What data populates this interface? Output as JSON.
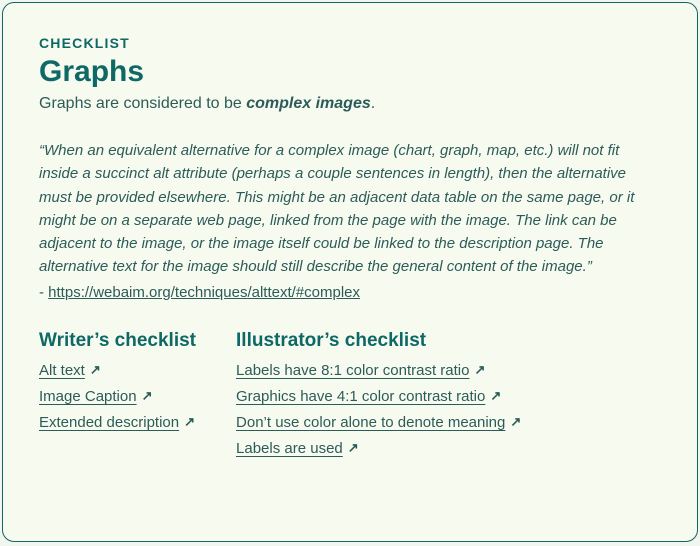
{
  "kicker": "CHECKLIST",
  "title": "Graphs",
  "subtitle_pre": "Graphs are considered to be ",
  "subtitle_em": "complex images",
  "subtitle_post": ".",
  "quote": "“When an equivalent alternative for a complex image (chart, graph, map, etc.) will not fit inside a succinct alt attribute (perhaps a couple sentences in length), then the alternative must be provided elsewhere. This might be an adjacent data table on the same page, or it might be on a separate web page, linked from the page with the image. The link can be adjacent to the image, or the image itself could be linked to the description page. The alternative text for the image should still describe the general content of the image.”",
  "attribution_prefix": "- ",
  "attribution_link": "https://webaim.org/techniques/alttext/#complex",
  "writer": {
    "heading": "Writer’s checklist",
    "items": [
      {
        "label": "Alt text"
      },
      {
        "label": "Image Caption"
      },
      {
        "label": "Extended description"
      }
    ]
  },
  "illustrator": {
    "heading": "Illustrator’s checklist",
    "items": [
      {
        "label": "Labels have 8:1 color contrast ratio"
      },
      {
        "label": "Graphics have 4:1 color contrast ratio"
      },
      {
        "label": "Don’t use color alone to denote meaning"
      },
      {
        "label": "Labels are used"
      }
    ]
  },
  "arrow_glyph": "↗"
}
